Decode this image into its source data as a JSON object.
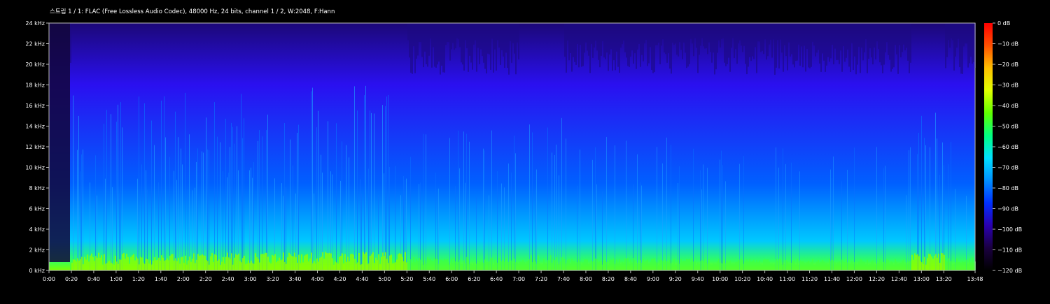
{
  "header": {
    "title": "스트림 1 / 1: FLAC (Free Lossless Audio Codec), 48000 Hz, 24 bits, channel 1 / 2, W:2048, F:Hann"
  },
  "chart_data": {
    "type": "heatmap",
    "title": "스트림 1 / 1: FLAC (Free Lossless Audio Codec), 48000 Hz, 24 bits, channel 1 / 2, W:2048, F:Hann",
    "duration_seconds": 828,
    "ylim_hz": [
      0,
      24000
    ],
    "y_ticks": [
      {
        "value": 0,
        "label": "0 kHz"
      },
      {
        "value": 2000,
        "label": "2 kHz"
      },
      {
        "value": 4000,
        "label": "4 kHz"
      },
      {
        "value": 6000,
        "label": "6 kHz"
      },
      {
        "value": 8000,
        "label": "8 kHz"
      },
      {
        "value": 10000,
        "label": "10 kHz"
      },
      {
        "value": 12000,
        "label": "12 kHz"
      },
      {
        "value": 14000,
        "label": "14 kHz"
      },
      {
        "value": 16000,
        "label": "16 kHz"
      },
      {
        "value": 18000,
        "label": "18 kHz"
      },
      {
        "value": 20000,
        "label": "20 kHz"
      },
      {
        "value": 22000,
        "label": "22 kHz"
      },
      {
        "value": 24000,
        "label": "24 kHz"
      }
    ],
    "x_ticks": [
      {
        "value": 0,
        "label": "0:00"
      },
      {
        "value": 20,
        "label": "0:20"
      },
      {
        "value": 40,
        "label": "0:40"
      },
      {
        "value": 60,
        "label": "1:00"
      },
      {
        "value": 80,
        "label": "1:20"
      },
      {
        "value": 100,
        "label": "1:40"
      },
      {
        "value": 120,
        "label": "2:00"
      },
      {
        "value": 140,
        "label": "2:20"
      },
      {
        "value": 160,
        "label": "2:40"
      },
      {
        "value": 180,
        "label": "3:00"
      },
      {
        "value": 200,
        "label": "3:20"
      },
      {
        "value": 220,
        "label": "3:40"
      },
      {
        "value": 240,
        "label": "4:00"
      },
      {
        "value": 260,
        "label": "4:20"
      },
      {
        "value": 280,
        "label": "4:40"
      },
      {
        "value": 300,
        "label": "5:00"
      },
      {
        "value": 320,
        "label": "5:20"
      },
      {
        "value": 340,
        "label": "5:40"
      },
      {
        "value": 360,
        "label": "6:00"
      },
      {
        "value": 380,
        "label": "6:20"
      },
      {
        "value": 400,
        "label": "6:40"
      },
      {
        "value": 420,
        "label": "7:00"
      },
      {
        "value": 440,
        "label": "7:20"
      },
      {
        "value": 460,
        "label": "7:40"
      },
      {
        "value": 480,
        "label": "8:00"
      },
      {
        "value": 500,
        "label": "8:20"
      },
      {
        "value": 520,
        "label": "8:40"
      },
      {
        "value": 540,
        "label": "9:00"
      },
      {
        "value": 560,
        "label": "9:20"
      },
      {
        "value": 580,
        "label": "9:40"
      },
      {
        "value": 600,
        "label": "10:00"
      },
      {
        "value": 620,
        "label": "10:20"
      },
      {
        "value": 640,
        "label": "10:40"
      },
      {
        "value": 660,
        "label": "11:00"
      },
      {
        "value": 680,
        "label": "11:20"
      },
      {
        "value": 700,
        "label": "11:40"
      },
      {
        "value": 720,
        "label": "12:00"
      },
      {
        "value": 740,
        "label": "12:20"
      },
      {
        "value": 760,
        "label": "12:40"
      },
      {
        "value": 780,
        "label": "13:00"
      },
      {
        "value": 800,
        "label": "13:20"
      },
      {
        "value": 828,
        "label": "13:48"
      }
    ],
    "colorbar": {
      "range_db": [
        -120,
        0
      ],
      "ticks": [
        {
          "value": 0,
          "label": "0 dB"
        },
        {
          "value": -10,
          "label": "−10 dB"
        },
        {
          "value": -20,
          "label": "−20 dB"
        },
        {
          "value": -30,
          "label": "−30 dB"
        },
        {
          "value": -40,
          "label": "−40 dB"
        },
        {
          "value": -50,
          "label": "−50 dB"
        },
        {
          "value": -60,
          "label": "−60 dB"
        },
        {
          "value": -70,
          "label": "−70 dB"
        },
        {
          "value": -80,
          "label": "−80 dB"
        },
        {
          "value": -90,
          "label": "−90 dB"
        },
        {
          "value": -100,
          "label": "−100 dB"
        },
        {
          "value": -110,
          "label": "−110 dB"
        },
        {
          "value": -120,
          "label": "−120 dB"
        }
      ],
      "colors": [
        "#000000",
        "#1a0040",
        "#2a00b0",
        "#0030ff",
        "#0090ff",
        "#00e0ff",
        "#00ff80",
        "#60ff00",
        "#e0ff00",
        "#ffc000",
        "#ff5000",
        "#ff0000"
      ]
    },
    "intensity_profile": {
      "segments": [
        {
          "t0": 0,
          "t1": 20,
          "level": 0.15
        },
        {
          "t0": 20,
          "t1": 200,
          "level": 0.7
        },
        {
          "t0": 200,
          "t1": 320,
          "level": 0.75
        },
        {
          "t0": 320,
          "t1": 420,
          "level": 0.45
        },
        {
          "t0": 420,
          "t1": 460,
          "level": 0.55
        },
        {
          "t0": 460,
          "t1": 580,
          "level": 0.4
        },
        {
          "t0": 580,
          "t1": 770,
          "level": 0.35
        },
        {
          "t0": 770,
          "t1": 800,
          "level": 0.7
        },
        {
          "t0": 800,
          "t1": 828,
          "level": 0.45
        }
      ]
    }
  }
}
